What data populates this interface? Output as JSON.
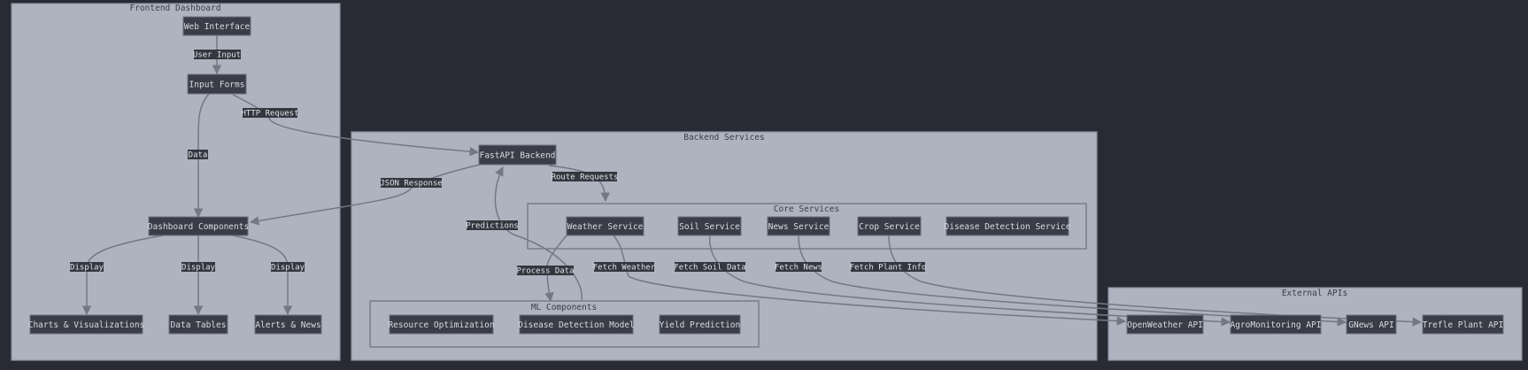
{
  "clusters": {
    "frontend": "Frontend Dashboard",
    "backend": "Backend Services",
    "core": "Core Services",
    "ml": "ML Components",
    "external": "External APIs"
  },
  "nodes": {
    "web_interface": "Web Interface",
    "input_forms": "Input Forms",
    "dashboard_components": "Dashboard Components",
    "charts": "Charts & Visualizations",
    "data_tables": "Data Tables",
    "alerts_news": "Alerts & News",
    "fastapi_backend": "FastAPI Backend",
    "weather_service": "Weather Service",
    "soil_service": "Soil Service",
    "news_service": "News Service",
    "crop_service": "Crop Service",
    "disease_detection_service": "Disease Detection Service",
    "resource_optimization": "Resource Optimization",
    "disease_detection_model": "Disease Detection Model",
    "yield_prediction": "Yield Prediction",
    "openweather_api": "OpenWeather API",
    "agromonitoring_api": "AgroMonitoring API",
    "gnews_api": "GNews API",
    "trefle_api": "Trefle Plant API"
  },
  "edge_labels": {
    "user_input": "User Input",
    "http_request": "HTTP Request",
    "data": "Data",
    "json_response": "JSON Response",
    "route_requests": "Route Requests",
    "predictions": "Predictions",
    "display_charts": "Display",
    "display_tables": "Display",
    "display_alerts": "Display",
    "process_data": "Process Data",
    "fetch_weather": "Fetch Weather",
    "fetch_soil": "Fetch Soil Data",
    "fetch_news": "Fetch News",
    "fetch_plant": "Fetch Plant Info"
  },
  "colors": {
    "background": "#282b34",
    "cluster_fill": "#aeb3c0",
    "node_fill": "#3a3d48",
    "node_text": "#d8dbe3",
    "edge": "#737886"
  }
}
